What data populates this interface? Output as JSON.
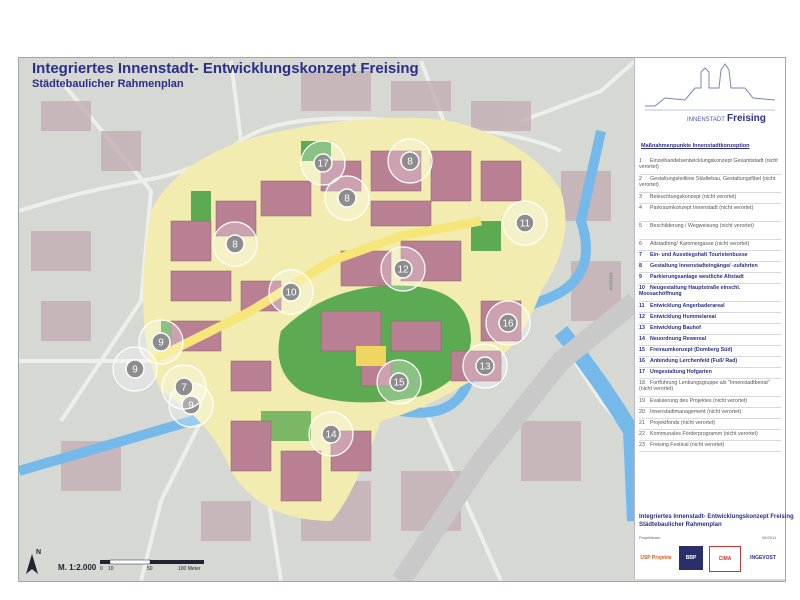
{
  "map": {
    "title": "Integriertes Innenstadt- Entwicklungskonzept Freising",
    "subtitle": "Städtebaulicher Rahmenplan",
    "scale_label": "M. 1:2.000",
    "north_label": "N",
    "scale_ticks": [
      "0",
      "10",
      "50",
      "100 Meter"
    ],
    "markers": [
      "17",
      "8",
      "8",
      "8",
      "11",
      "12",
      "10",
      "16",
      "9",
      "9",
      "9",
      "7",
      "13",
      "15",
      "14"
    ],
    "colors": {
      "water": "#74b9ea",
      "green": "#5cab52",
      "buildings": "#b97f93",
      "plaza": "#f3e79c",
      "street": "#f5f1b8"
    }
  },
  "legend": {
    "brand_small": "INNENSTADT",
    "brand_large": "Freising",
    "heading": "Maßnahmenpunkte Innenstadtkonzeption",
    "items": [
      {
        "n": "1",
        "label": "Einzelhandelsentwicklungskonzept Gesamtstadt (nicht verortet)",
        "bold": false
      },
      {
        "n": "2",
        "label": "Gestaltungsleitlinie Städtebau, Gestaltungsfibel (nicht verortet)",
        "bold": false
      },
      {
        "n": "3",
        "label": "Beleuchtungskonzept (nicht verortet)",
        "bold": false
      },
      {
        "n": "4",
        "label": "Parkraumkonzept Innenstadt (nicht verortet)",
        "bold": false
      },
      {
        "n": "5",
        "label": "Beschilderung / Wegweisung (nicht verortet)",
        "bold": false
      },
      {
        "n": "6",
        "label": "Altstadtring/ Kammergasse (nicht verortet)",
        "bold": false
      },
      {
        "n": "7",
        "label": "Ein- und Ausstiegshalt Touristenbusse",
        "bold": true
      },
      {
        "n": "8",
        "label": "Gestaltung Innenstadteingänge/ -zufahrten",
        "bold": true
      },
      {
        "n": "9",
        "label": "Parkierungsanlage westliche Altstadt",
        "bold": true
      },
      {
        "n": "10",
        "label": "Neugestaltung Hauptstraße einschl. Moosachöffnung",
        "bold": true
      },
      {
        "n": "11",
        "label": "Entwicklung Angerbaderareal",
        "bold": true
      },
      {
        "n": "12",
        "label": "Entwicklung Hummelareal",
        "bold": true
      },
      {
        "n": "13",
        "label": "Entwicklung Bauhof",
        "bold": true
      },
      {
        "n": "14",
        "label": "Neuordnung Rewereal",
        "bold": true
      },
      {
        "n": "15",
        "label": "Freiraumkonzept (Domberg Süd)",
        "bold": true
      },
      {
        "n": "16",
        "label": "Anbindung Lerchenfeld (Fuß/ Rad)",
        "bold": true
      },
      {
        "n": "17",
        "label": "Umgestaltung Hofgarten",
        "bold": true
      },
      {
        "n": "18",
        "label": "Fortführung Lenkungsgruppe als \"Innenstadtbeirat\" (nicht verortet)",
        "bold": false
      },
      {
        "n": "19",
        "label": "Evaluierung des Projektes (nicht verortet)",
        "bold": false
      },
      {
        "n": "20",
        "label": "Innenstadtmanagement (nicht verortet)",
        "bold": false
      },
      {
        "n": "21",
        "label": "Projektfonds (nicht verortet)",
        "bold": false
      },
      {
        "n": "22",
        "label": "Kommunales Förderprogramm (nicht verortet)",
        "bold": false
      },
      {
        "n": "23",
        "label": "Freising Festival (nicht verortet)",
        "bold": false
      }
    ],
    "footer_title": "Integriertes Innenstadt- Entwicklungskonzept Freising",
    "footer_subtitle": "Städtebaulicher Rahmenplan",
    "footer_left": "Projektteam",
    "footer_date": "06/2011",
    "logos": [
      "USP Projekte",
      "BBP",
      "CIMA",
      "INGEVOST"
    ]
  }
}
